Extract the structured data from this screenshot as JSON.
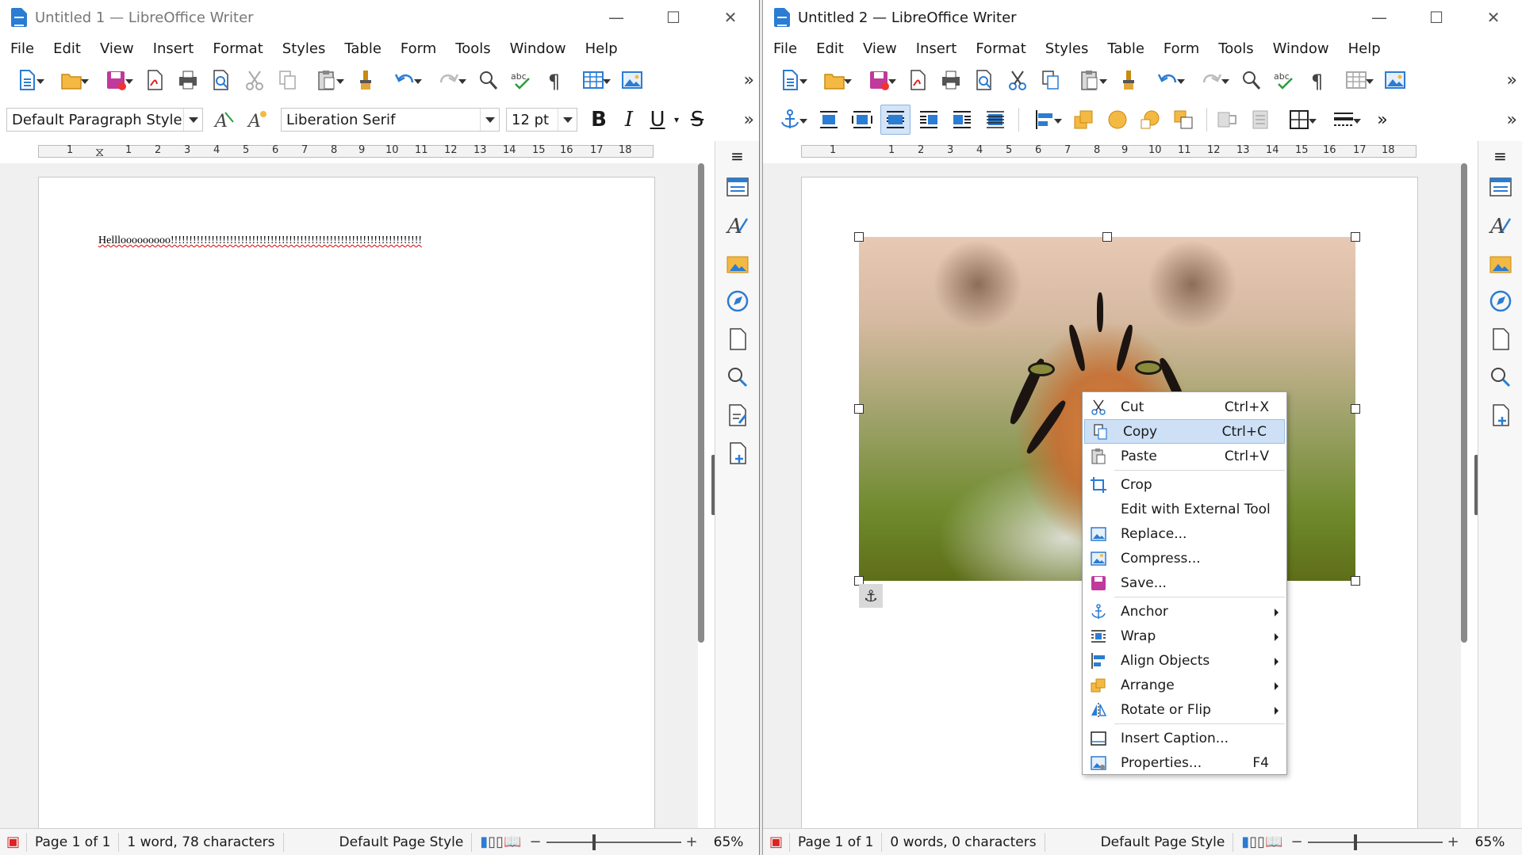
{
  "colors": {
    "accent": "#2b7cd3",
    "selection": "#cde0f5"
  },
  "window1": {
    "title": "Untitled 1 — LibreOffice Writer",
    "menu": [
      "File",
      "Edit",
      "View",
      "Insert",
      "Format",
      "Styles",
      "Table",
      "Form",
      "Tools",
      "Window",
      "Help"
    ],
    "paragraph_style": "Default Paragraph Style",
    "font_name": "Liberation Serif",
    "font_size": "12 pt",
    "bold": "B",
    "italic": "I",
    "underline": "U",
    "strike": "S",
    "ruler_numbers": [
      "1",
      "1",
      "2",
      "3",
      "4",
      "5",
      "6",
      "7",
      "8",
      "9",
      "10",
      "11",
      "12",
      "13",
      "14",
      "15",
      "16",
      "17",
      "18"
    ],
    "document_text": "Helllooooooooo!!!!!!!!!!!!!!!!!!!!!!!!!!!!!!!!!!!!!!!!!!!!!!!!!!!!!!!!!!!!!!!!!!!!",
    "status": {
      "page": "Page 1 of 1",
      "words": "1 word, 78 characters",
      "page_style": "Default Page Style",
      "zoom": "65%"
    }
  },
  "window2": {
    "title": "Untitled 2 — LibreOffice Writer",
    "menu": [
      "File",
      "Edit",
      "View",
      "Insert",
      "Format",
      "Styles",
      "Table",
      "Form",
      "Tools",
      "Window",
      "Help"
    ],
    "ruler_numbers": [
      "1",
      "1",
      "2",
      "3",
      "4",
      "5",
      "6",
      "7",
      "8",
      "9",
      "10",
      "11",
      "12",
      "13",
      "14",
      "15",
      "16",
      "17",
      "18"
    ],
    "status": {
      "page": "Page 1 of 1",
      "words": "0 words, 0 characters",
      "page_style": "Default Page Style",
      "zoom": "65%"
    }
  },
  "context_menu": {
    "items": [
      {
        "label": "Cut",
        "shortcut": "Ctrl+X",
        "icon": "cut-icon"
      },
      {
        "label": "Copy",
        "shortcut": "Ctrl+C",
        "icon": "copy-icon",
        "highlighted": true
      },
      {
        "label": "Paste",
        "shortcut": "Ctrl+V",
        "icon": "paste-icon"
      },
      {
        "label": "Crop",
        "shortcut": "",
        "icon": "crop-icon"
      },
      {
        "label": "Edit with External Tool",
        "shortcut": "",
        "icon": ""
      },
      {
        "label": "Replace...",
        "shortcut": "",
        "icon": "replace-image-icon"
      },
      {
        "label": "Compress...",
        "shortcut": "",
        "icon": "compress-image-icon"
      },
      {
        "label": "Save...",
        "shortcut": "",
        "icon": "save-icon"
      },
      {
        "label": "Anchor",
        "shortcut": "",
        "icon": "anchor-icon",
        "submenu": true
      },
      {
        "label": "Wrap",
        "shortcut": "",
        "icon": "wrap-icon",
        "submenu": true
      },
      {
        "label": "Align Objects",
        "shortcut": "",
        "icon": "align-objects-icon",
        "submenu": true
      },
      {
        "label": "Arrange",
        "shortcut": "",
        "icon": "arrange-icon",
        "submenu": true
      },
      {
        "label": "Rotate or Flip",
        "shortcut": "",
        "icon": "rotate-icon",
        "submenu": true
      },
      {
        "label": "Insert Caption...",
        "shortcut": "",
        "icon": "caption-icon"
      },
      {
        "label": "Properties...",
        "shortcut": "F4",
        "icon": "properties-icon"
      }
    ]
  }
}
